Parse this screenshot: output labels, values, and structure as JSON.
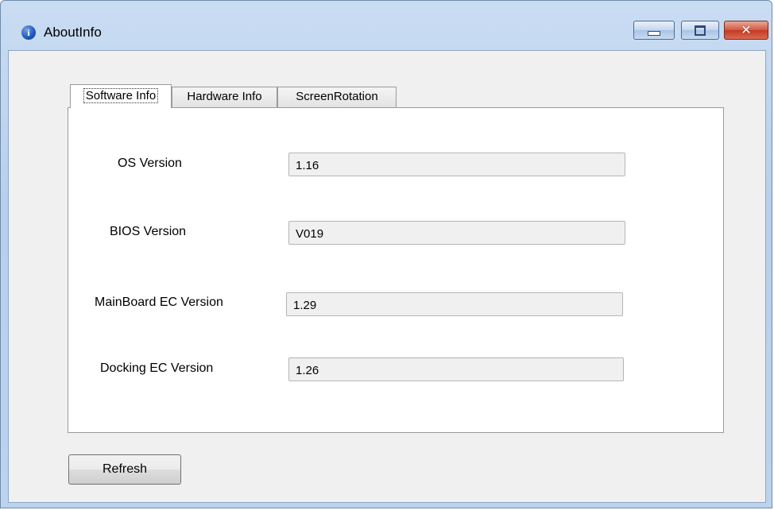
{
  "window": {
    "title": "AboutInfo",
    "controls": {
      "minimize": "minimize",
      "maximize": "maximize",
      "close": "✕"
    }
  },
  "tabs": [
    {
      "label": "Software Info",
      "selected": true
    },
    {
      "label": "Hardware Info",
      "selected": false
    },
    {
      "label": "ScreenRotation",
      "selected": false
    }
  ],
  "fields": [
    {
      "label": "OS Version",
      "value": "1.16"
    },
    {
      "label": "BIOS Version",
      "value": "V019"
    },
    {
      "label": "MainBoard EC Version",
      "value": "1.29"
    },
    {
      "label": "Docking EC Version",
      "value": "1.26"
    }
  ],
  "buttons": {
    "refresh": "Refresh"
  },
  "colors": {
    "window_frame": "#b8d0ec",
    "client_bg": "#f0f0f0",
    "close_button": "#c23a22"
  },
  "icons": {
    "title": "info-icon"
  }
}
